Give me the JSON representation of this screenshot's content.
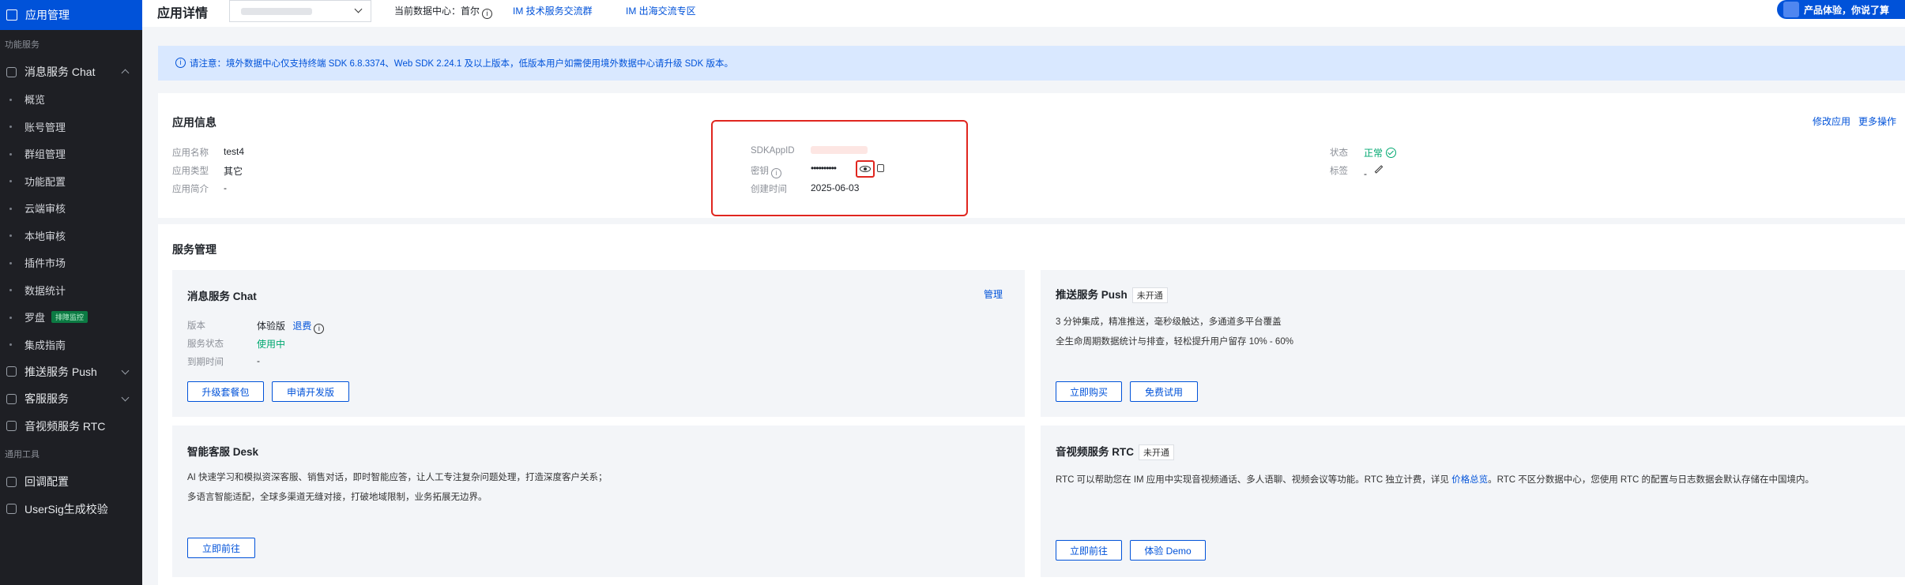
{
  "sidebar": {
    "active": "应用管理",
    "group_features": "功能服务",
    "chat": "消息服务 Chat",
    "chat_sub": [
      "概览",
      "账号管理",
      "群组管理",
      "功能配置",
      "云端审核",
      "本地审核",
      "插件市场",
      "数据统计",
      "罗盘",
      "集成指南"
    ],
    "compass_badge": "排障监控",
    "push": "推送服务 Push",
    "desk": "客服服务",
    "rtc": "音视频服务 RTC",
    "group_tools": "通用工具",
    "callback": "回调配置",
    "usersig": "UserSig生成校验"
  },
  "header": {
    "title": "应用详情",
    "dc_label": "当前数据中心：",
    "dc_value": "首尔",
    "link_group": "IM 技术服务交流群",
    "link_overseas": "IM 出海交流专区",
    "cta": "产品体验，你说了算"
  },
  "notice": "请注意：境外数据中心仅支持终端 SDK 6.8.3374、Web SDK 2.24.1 及以上版本，低版本用户如需使用境外数据中心请升级 SDK 版本。",
  "app_info": {
    "title": "应用信息",
    "edit": "修改应用",
    "more": "更多操作",
    "name_label": "应用名称",
    "name": "test4",
    "type_label": "应用类型",
    "type": "其它",
    "intro_label": "应用简介",
    "intro": "-",
    "sdkappid_label": "SDKAppID",
    "secret_label": "密钥",
    "secret": "••••••••••",
    "created_label": "创建时间",
    "created": "2025-06-03",
    "status_label": "状态",
    "status": "正常",
    "tag_label": "标签",
    "tag": "-"
  },
  "services": {
    "title": "服务管理",
    "chat": {
      "title": "消息服务 Chat",
      "manage": "管理",
      "version_label": "版本",
      "version": "体验版",
      "refund": "退费",
      "state_label": "服务状态",
      "state": "使用中",
      "expire_label": "到期时间",
      "expire": "-",
      "btn_upgrade": "升级套餐包",
      "btn_dev": "申请开发版"
    },
    "push": {
      "title": "推送服务 Push",
      "tag": "未开通",
      "line1": "3 分钟集成，精准推送，毫秒级触达，多通道多平台覆盖",
      "line2": "全生命周期数据统计与排查，轻松提升用户留存 10% - 60%",
      "btn_buy": "立即购买",
      "btn_try": "免费试用"
    },
    "desk": {
      "title": "智能客服 Desk",
      "line1": "AI 快速学习和模拟资深客服、销售对话，即时智能应答，让人工专注复杂问题处理，打造深度客户关系；",
      "line2": "多语言智能适配，全球多渠道无缝对接，打破地域限制，业务拓展无边界。",
      "btn_go": "立即前往"
    },
    "rtc": {
      "title": "音视频服务 RTC",
      "tag": "未开通",
      "line1a": "RTC 可以帮助您在 IM 应用中实现音视频通话、多人语聊、视频会议等功能。RTC 独立计费，详见",
      "line1_link": "价格总览",
      "line1b": "。RTC 不区分数据中心，您使用 RTC 的配置与日志数据会默认存储在中国境内。",
      "btn_go": "立即前往",
      "btn_demo": "体验 Demo"
    }
  }
}
